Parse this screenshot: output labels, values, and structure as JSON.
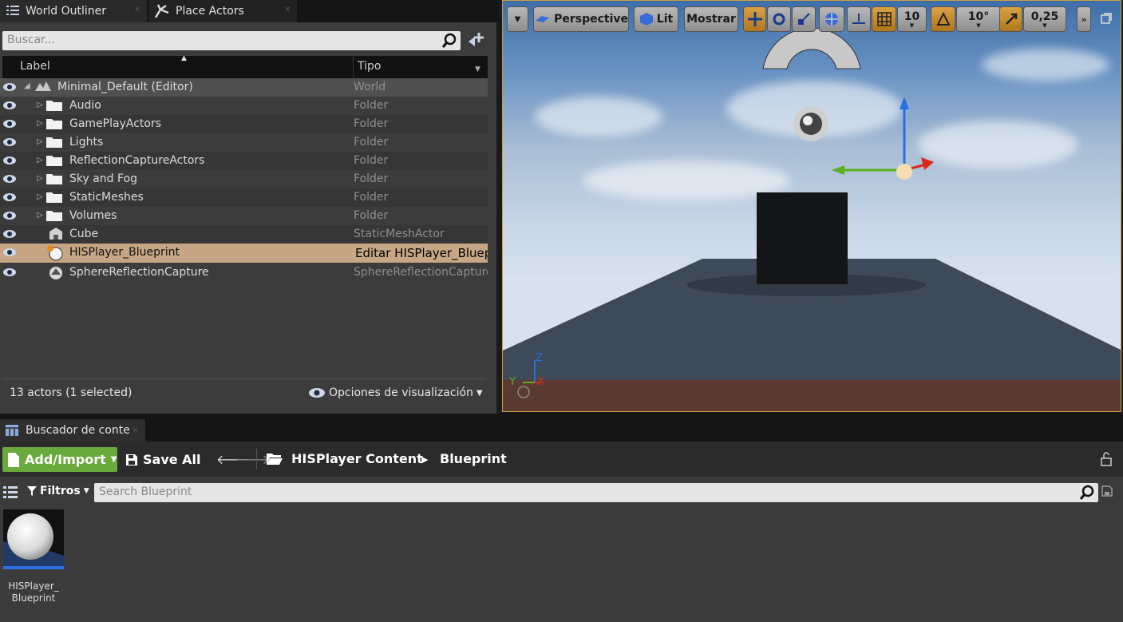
{
  "tabs": {
    "world_outliner": "World Outliner",
    "place_actors": "Place Actors"
  },
  "outliner": {
    "search_placeholder": "Buscar...",
    "col_label": "Label",
    "col_type": "Tipo",
    "rows": [
      {
        "label": "Minimal_Default (Editor)",
        "type": "World"
      },
      {
        "label": "Audio",
        "type": "Folder"
      },
      {
        "label": "GamePlayActors",
        "type": "Folder"
      },
      {
        "label": "Lights",
        "type": "Folder"
      },
      {
        "label": "ReflectionCaptureActors",
        "type": "Folder"
      },
      {
        "label": "Sky and Fog",
        "type": "Folder"
      },
      {
        "label": "StaticMeshes",
        "type": "Folder"
      },
      {
        "label": "Volumes",
        "type": "Folder"
      },
      {
        "label": "Cube",
        "type": "StaticMeshActor"
      },
      {
        "label": "HISPlayer_Blueprint",
        "type": "Editar HISPlayer_Blueprint"
      },
      {
        "label": "SphereReflectionCapture",
        "type": "SphereReflectionCapture"
      }
    ],
    "count": "13 actors (1 selected)",
    "view_options": "Opciones de visualización"
  },
  "viewport": {
    "perspective": "Perspective",
    "lit": "Lit",
    "show": "Mostrar",
    "grid_snap": "10",
    "rot_snap": "10°",
    "scale_snap": "0,25",
    "axis_z": "Z",
    "axis_y": "Y",
    "axis_x": "X"
  },
  "content_browser": {
    "tab": "Buscador de conte",
    "add_import": "Add/Import",
    "save_all": "Save All",
    "crumb_root": "HISPlayer Content",
    "crumb_leaf": "Blueprint",
    "filters": "Filtros",
    "search_placeholder": "Search Blueprint",
    "asset_label_1": "HISPlayer_",
    "asset_label_2": "Blueprint"
  },
  "colors": {
    "selection": "#c6a684",
    "add_import": "#6aaa3c",
    "viewport_border": "#c8a040"
  }
}
